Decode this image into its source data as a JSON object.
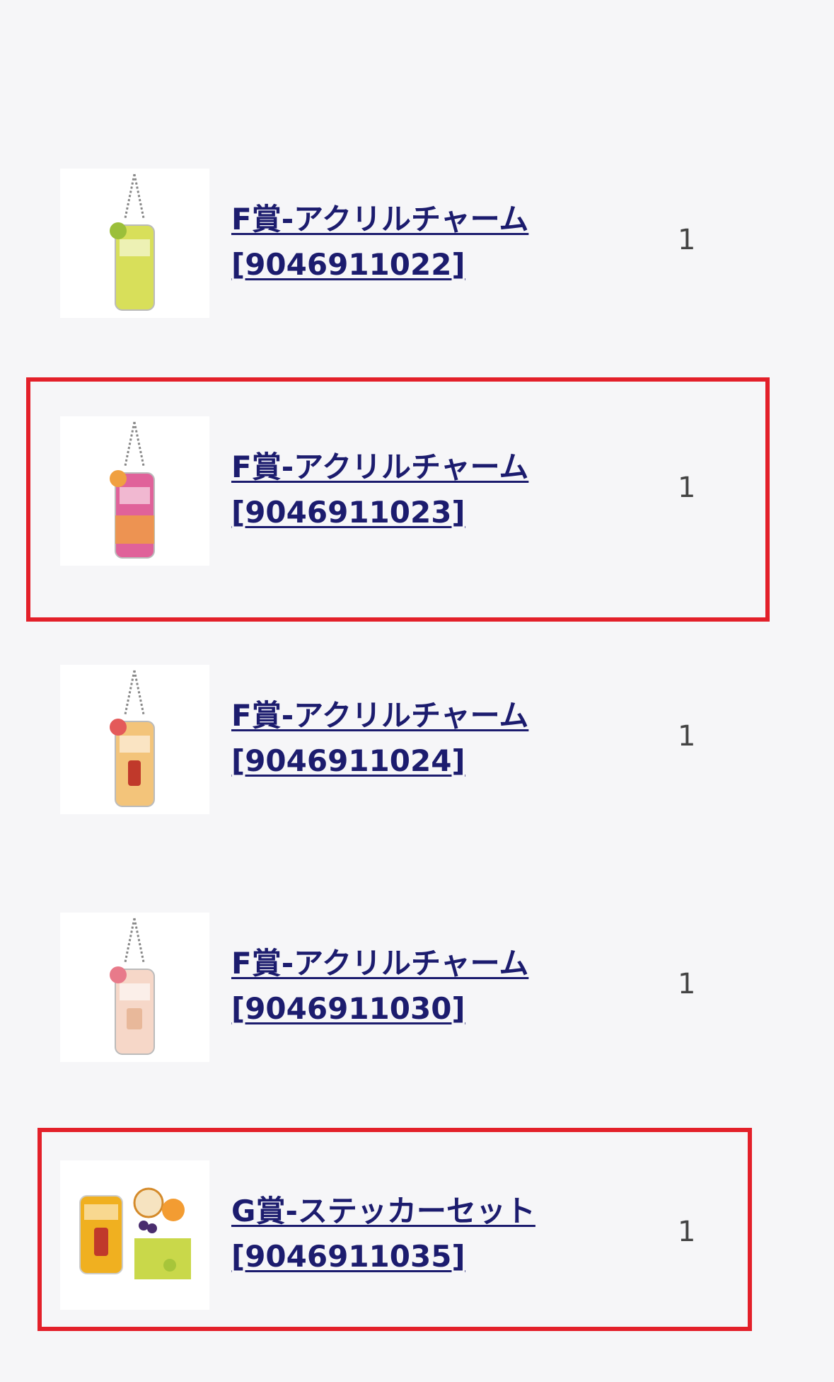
{
  "items": [
    {
      "title": "F賞-アクリルチャーム",
      "code": "[9046911022]",
      "qty": "1",
      "can_color": "#d8df5a",
      "accent": "#9bbf3a",
      "highlighted": false
    },
    {
      "title": "F賞-アクリルチャーム",
      "code": "[9046911023]",
      "qty": "1",
      "can_color": "#e0629a",
      "accent": "#f0a040",
      "highlighted": true
    },
    {
      "title": "F賞-アクリルチャーム",
      "code": "[9046911024]",
      "qty": "1",
      "can_color": "#f3c47a",
      "accent": "#e45a5a",
      "highlighted": false
    },
    {
      "title": "F賞-アクリルチャーム",
      "code": "[9046911030]",
      "qty": "1",
      "can_color": "#f6d7c8",
      "accent": "#e87a8a",
      "highlighted": false
    },
    {
      "title": "G賞-ステッカーセット",
      "code": "[9046911035]",
      "qty": "1",
      "can_color": "#f0b020",
      "accent": "#c9d84a",
      "highlighted": true
    }
  ],
  "colors": {
    "highlight_border": "#e3202a",
    "link": "#1c1c6e",
    "background": "#f6f6f8"
  }
}
